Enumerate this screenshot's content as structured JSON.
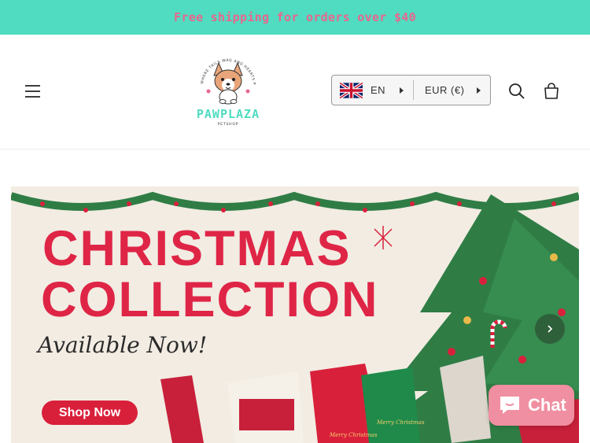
{
  "announcement": {
    "text": "Free shipping for orders over $40"
  },
  "header": {
    "logo": {
      "brand": "PAWPLAZA",
      "sub": "PETSHOP",
      "tagline": "WHERE TAILS WAG AND HEARTS PURR"
    },
    "language": {
      "code": "EN",
      "flag": "uk-flag-icon"
    },
    "currency": {
      "code": "EUR (€)"
    },
    "icons": [
      "menu-icon",
      "search-icon",
      "cart-icon"
    ]
  },
  "hero": {
    "title_line1": "CHRISTMAS",
    "title_line2": "COLLECTION",
    "subtitle": "Available Now!",
    "cta": "Shop Now",
    "sweater_texts": [
      "Merry Christmas",
      "Merry Christmas"
    ]
  },
  "chat": {
    "label": "Chat"
  },
  "colors": {
    "announcement_bg": "#4fdcc0",
    "announcement_text": "#e8668e",
    "hero_red": "#df2546",
    "hero_bg": "#f2ece3",
    "chat_bg": "#f08fa1",
    "logo_text": "#4fdcc0"
  }
}
